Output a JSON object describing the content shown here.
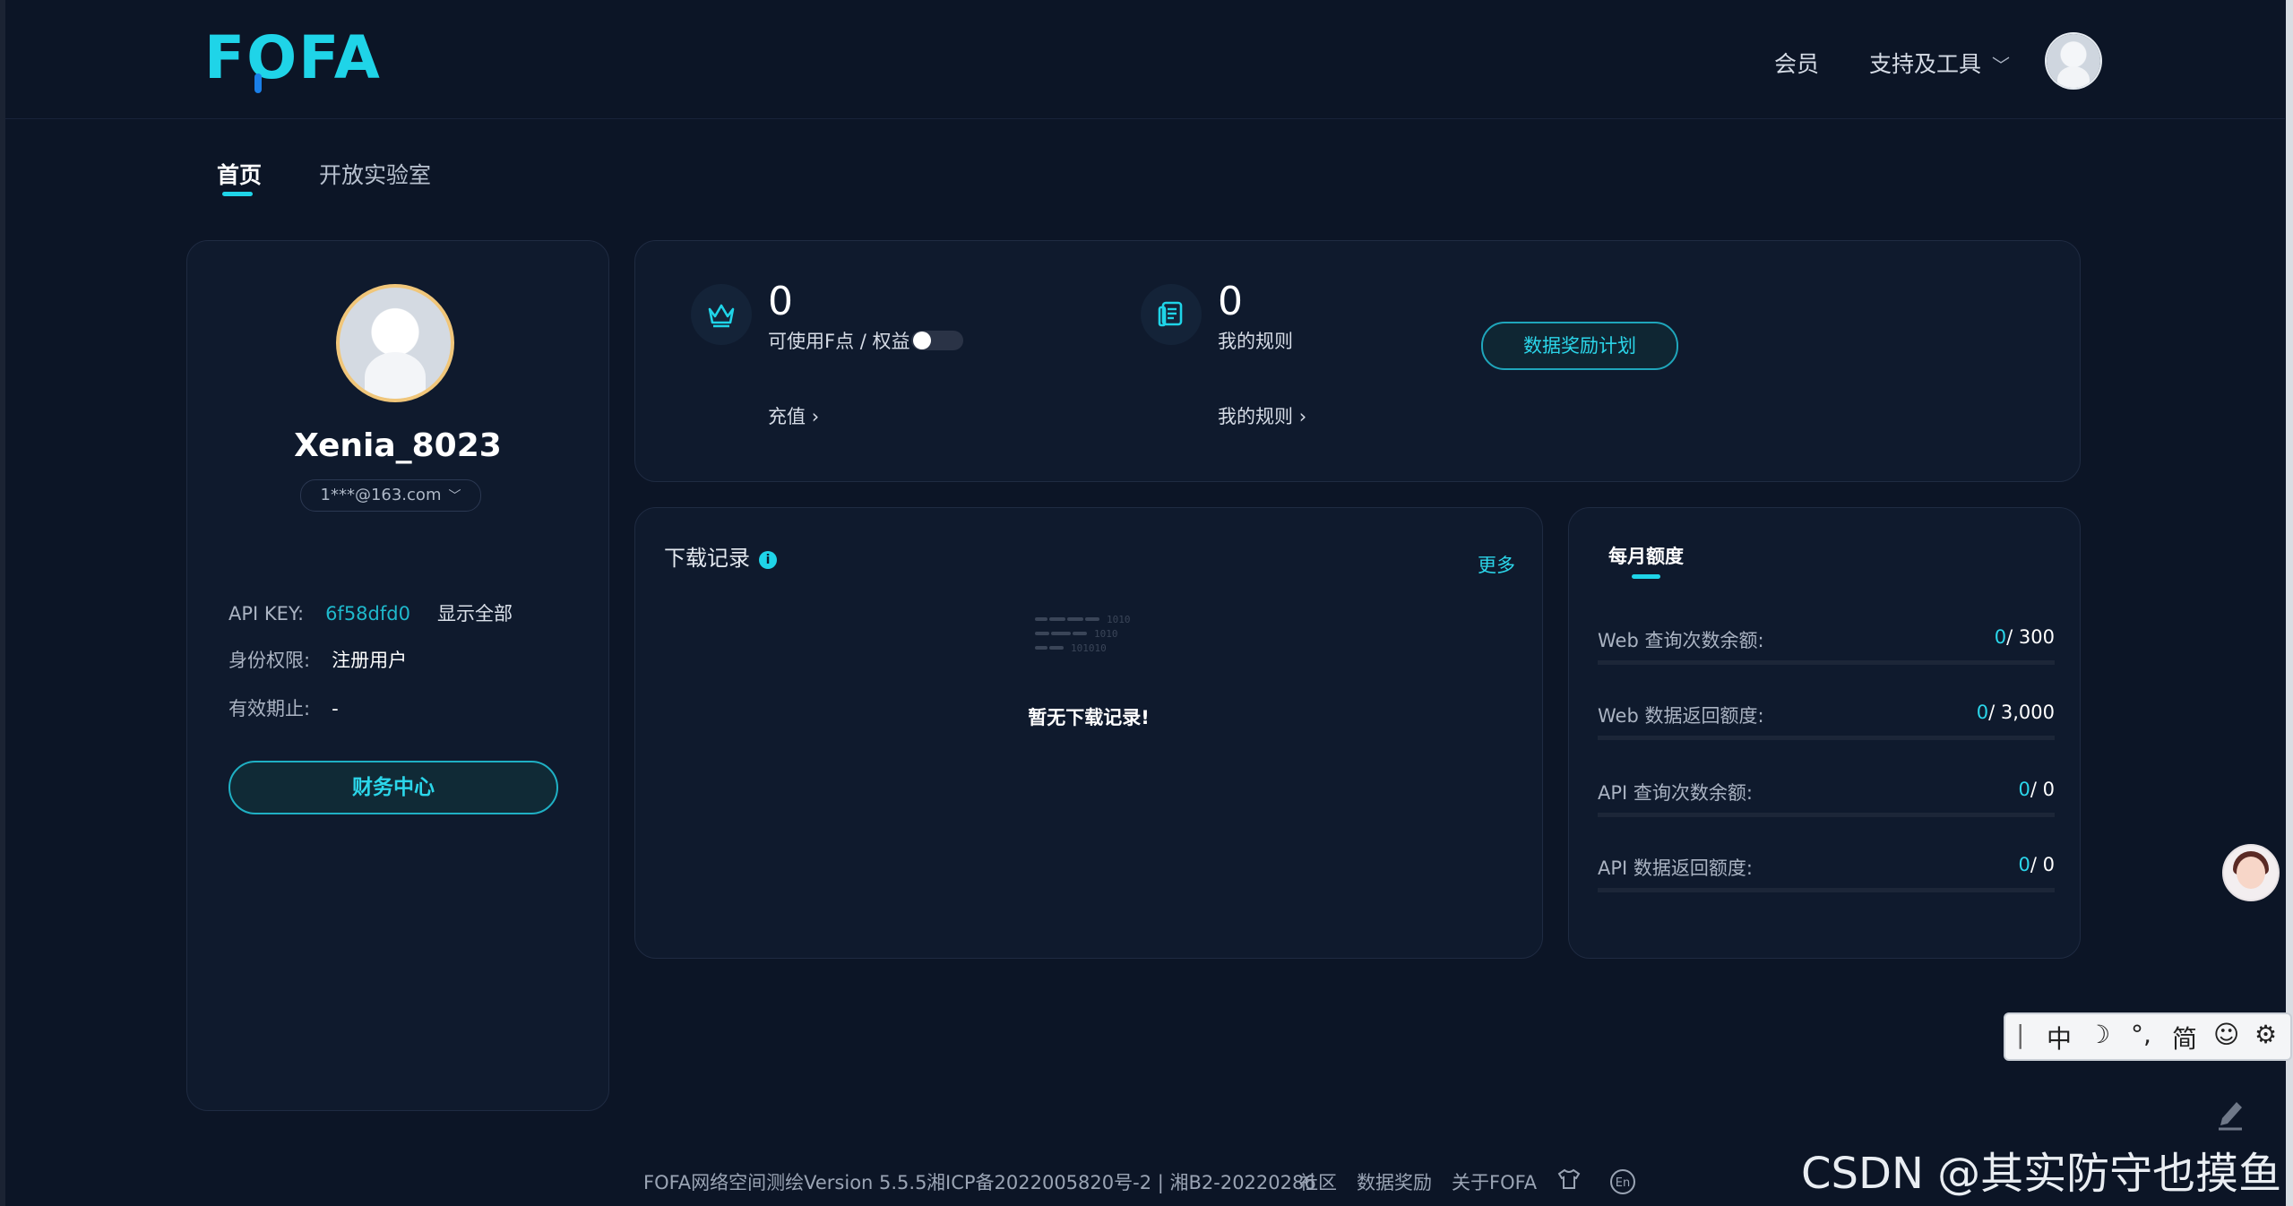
{
  "header": {
    "logo_text": "FOFA",
    "nav_member": "会员",
    "nav_tools": "支持及工具"
  },
  "tabs": {
    "home": "首页",
    "lab": "开放实验室"
  },
  "profile": {
    "username": "Xenia_8023",
    "email": "1***@163.com",
    "api_key_label": "API KEY:",
    "api_key_value": "6f58dfd0",
    "show_all": "显示全部",
    "role_label": "身份权限:",
    "role_value": "注册用户",
    "expiry_label": "有效期止:",
    "expiry_value": "-",
    "finance_button": "财务中心"
  },
  "stats": {
    "f_points": "0",
    "f_points_label": "可使用F点 / 权益",
    "recharge_link": "充值",
    "rules_count": "0",
    "rules_label": "我的规则",
    "rules_link": "我的规则",
    "reward_button": "数据奖励计划"
  },
  "downloads": {
    "title": "下载记录",
    "more": "更多",
    "empty_text": "暂无下载记录!",
    "art_text_1": "1010",
    "art_text_2": "1010",
    "art_text_3": "101010"
  },
  "monthly": {
    "title": "每月额度",
    "rows": [
      {
        "label": "Web 查询次数余额:",
        "used": "0",
        "total": "/ 300"
      },
      {
        "label": "Web 数据返回额度:",
        "used": "0",
        "total": "/ 3,000"
      },
      {
        "label": "API 查询次数余额:",
        "used": "0",
        "total": "/ 0"
      },
      {
        "label": "API 数据返回额度:",
        "used": "0",
        "total": "/ 0"
      }
    ]
  },
  "ime": {
    "mode": "中",
    "punct": "°,",
    "script": "简"
  },
  "footer": {
    "version": "FOFA网络空间测绘Version 5.5.5",
    "icp": "湘ICP备2022005820号-2 | 湘B2-20220286",
    "community": "社区",
    "data_reward": "数据奖励",
    "about": "关于FOFA",
    "lang": "En"
  },
  "watermark": "CSDN @其实防守也摸鱼",
  "colors": {
    "accent": "#1fd4e8",
    "background": "#0c1526",
    "card": "#0f1a2d"
  },
  "icons": [
    "crown-icon",
    "document-icon",
    "info-icon",
    "chevron-down-icon",
    "chevron-right-icon",
    "shirt-icon",
    "language-icon",
    "edit-icon",
    "moon-icon",
    "smile-icon",
    "gear-icon"
  ]
}
